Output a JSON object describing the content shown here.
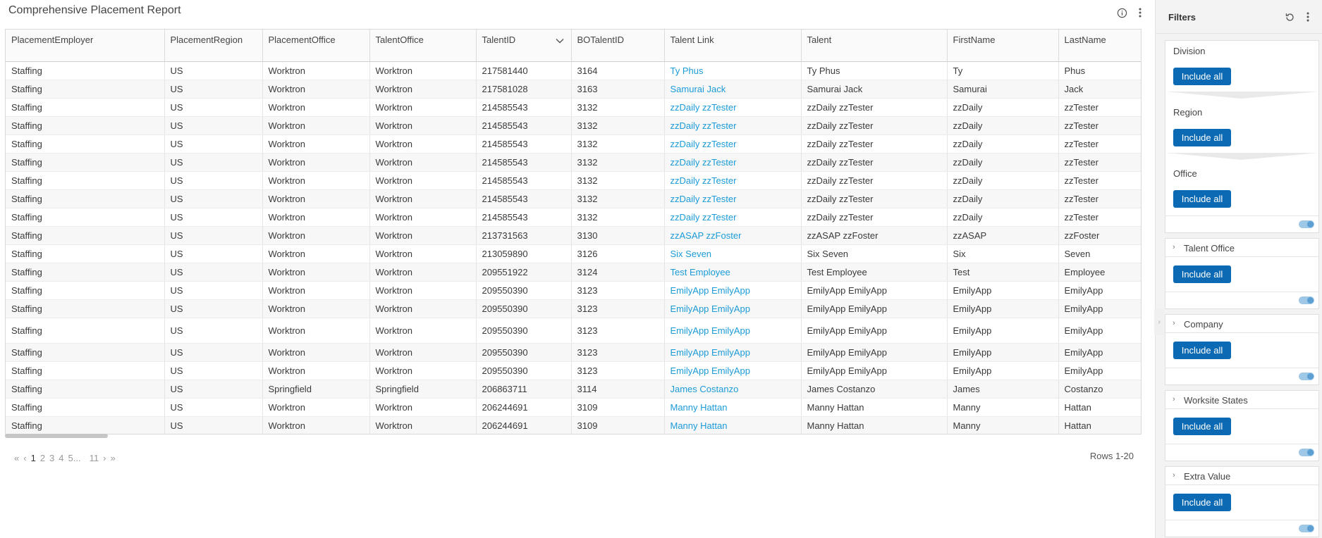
{
  "report": {
    "title": "Comprehensive Placement Report",
    "columns": [
      "PlacementEmployer",
      "PlacementRegion",
      "PlacementOffice",
      "TalentOffice",
      "TalentID",
      "BOTalentID",
      "Talent Link",
      "Talent",
      "FirstName",
      "LastName"
    ],
    "rows": [
      [
        "Staffing",
        "US",
        "Worktron",
        "Worktron",
        "217581440",
        "3164",
        "Ty Phus",
        "Ty Phus",
        "Ty",
        "Phus"
      ],
      [
        "Staffing",
        "US",
        "Worktron",
        "Worktron",
        "217581028",
        "3163",
        "Samurai Jack",
        "Samurai Jack",
        "Samurai",
        "Jack"
      ],
      [
        "Staffing",
        "US",
        "Worktron",
        "Worktron",
        "214585543",
        "3132",
        "zzDaily zzTester",
        "zzDaily zzTester",
        "zzDaily",
        "zzTester"
      ],
      [
        "Staffing",
        "US",
        "Worktron",
        "Worktron",
        "214585543",
        "3132",
        "zzDaily zzTester",
        "zzDaily zzTester",
        "zzDaily",
        "zzTester"
      ],
      [
        "Staffing",
        "US",
        "Worktron",
        "Worktron",
        "214585543",
        "3132",
        "zzDaily zzTester",
        "zzDaily zzTester",
        "zzDaily",
        "zzTester"
      ],
      [
        "Staffing",
        "US",
        "Worktron",
        "Worktron",
        "214585543",
        "3132",
        "zzDaily zzTester",
        "zzDaily zzTester",
        "zzDaily",
        "zzTester"
      ],
      [
        "Staffing",
        "US",
        "Worktron",
        "Worktron",
        "214585543",
        "3132",
        "zzDaily zzTester",
        "zzDaily zzTester",
        "zzDaily",
        "zzTester"
      ],
      [
        "Staffing",
        "US",
        "Worktron",
        "Worktron",
        "214585543",
        "3132",
        "zzDaily zzTester",
        "zzDaily zzTester",
        "zzDaily",
        "zzTester"
      ],
      [
        "Staffing",
        "US",
        "Worktron",
        "Worktron",
        "214585543",
        "3132",
        "zzDaily zzTester",
        "zzDaily zzTester",
        "zzDaily",
        "zzTester"
      ],
      [
        "Staffing",
        "US",
        "Worktron",
        "Worktron",
        "213731563",
        "3130",
        "zzASAP zzFoster",
        "zzASAP zzFoster",
        "zzASAP",
        "zzFoster"
      ],
      [
        "Staffing",
        "US",
        "Worktron",
        "Worktron",
        "213059890",
        "3126",
        "Six Seven",
        "Six Seven",
        "Six",
        "Seven"
      ],
      [
        "Staffing",
        "US",
        "Worktron",
        "Worktron",
        "209551922",
        "3124",
        "Test Employee",
        "Test Employee",
        "Test",
        "Employee"
      ],
      [
        "Staffing",
        "US",
        "Worktron",
        "Worktron",
        "209550390",
        "3123",
        "EmilyApp EmilyApp",
        "EmilyApp EmilyApp",
        "EmilyApp",
        "EmilyApp"
      ],
      [
        "Staffing",
        "US",
        "Worktron",
        "Worktron",
        "209550390",
        "3123",
        "EmilyApp EmilyApp",
        "EmilyApp EmilyApp",
        "EmilyApp",
        "EmilyApp"
      ],
      [
        "Staffing",
        "US",
        "Worktron",
        "Worktron",
        "209550390",
        "3123",
        "EmilyApp EmilyApp",
        "EmilyApp EmilyApp",
        "EmilyApp",
        "EmilyApp"
      ],
      [
        "Staffing",
        "US",
        "Worktron",
        "Worktron",
        "209550390",
        "3123",
        "EmilyApp EmilyApp",
        "EmilyApp EmilyApp",
        "EmilyApp",
        "EmilyApp"
      ],
      [
        "Staffing",
        "US",
        "Worktron",
        "Worktron",
        "209550390",
        "3123",
        "EmilyApp EmilyApp",
        "EmilyApp EmilyApp",
        "EmilyApp",
        "EmilyApp"
      ],
      [
        "Staffing",
        "US",
        "Springfield",
        "Springfield",
        "206863711",
        "3114",
        "James Costanzo",
        "James Costanzo",
        "James",
        "Costanzo"
      ],
      [
        "Staffing",
        "US",
        "Worktron",
        "Worktron",
        "206244691",
        "3109",
        "Manny Hattan",
        "Manny Hattan",
        "Manny",
        "Hattan"
      ],
      [
        "Staffing",
        "US",
        "Worktron",
        "Worktron",
        "206244691",
        "3109",
        "Manny Hattan",
        "Manny Hattan",
        "Manny",
        "Hattan"
      ]
    ],
    "pager": {
      "first": "«",
      "prev": "‹",
      "pages": [
        "1",
        "2",
        "3",
        "4",
        "5"
      ],
      "ellipsis": "...",
      "last_page": "11",
      "next": "›",
      "last": "»",
      "rows_info": "Rows 1-20"
    }
  },
  "filters": {
    "title": "Filters",
    "hierarchy": [
      {
        "label": "Division",
        "button": "Include all"
      },
      {
        "label": "Region",
        "button": "Include all"
      },
      {
        "label": "Office",
        "button": "Include all"
      }
    ],
    "cards": [
      {
        "label": "Talent Office",
        "button": "Include all"
      },
      {
        "label": "Company",
        "button": "Include all"
      },
      {
        "label": "Worksite States",
        "button": "Include all"
      },
      {
        "label": "Extra Value",
        "button": "Include all"
      }
    ]
  },
  "colors": {
    "link": "#1b9bd8",
    "button": "#0b6ab3",
    "toggle": "#5b9fd3"
  }
}
